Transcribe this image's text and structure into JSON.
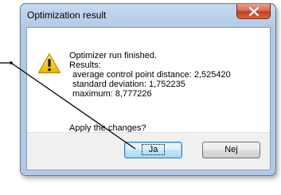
{
  "window": {
    "title": "Optimization result"
  },
  "icon": {
    "name": "warning-icon",
    "color": "#f5c400"
  },
  "message": {
    "heading": "Optimizer run finished.",
    "results_label": "Results:",
    "lines": [
      "average control point distance: 2,525420",
      "standard deviation: 1,752235",
      "maximum: 8,777226"
    ],
    "question": "Apply the changes?"
  },
  "buttons": {
    "yes_label": "Ja",
    "no_label": "Nej"
  },
  "colors": {
    "close_button": "#c13d1e",
    "default_button_border": "#3c7fb1"
  }
}
